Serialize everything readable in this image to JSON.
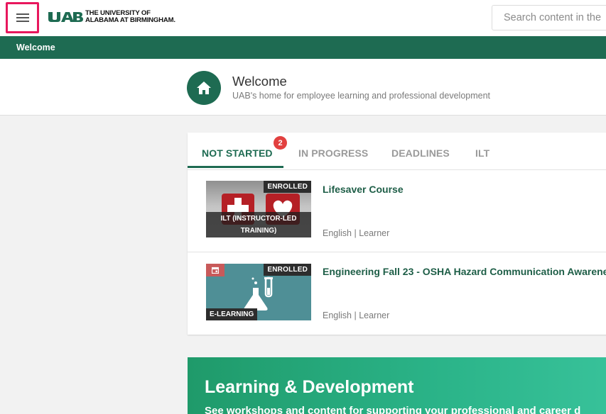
{
  "header": {
    "logo_mark": "UAB",
    "logo_line1": "THE UNIVERSITY OF",
    "logo_line2": "ALABAMA AT BIRMINGHAM.",
    "search_placeholder": "Search content in the p"
  },
  "nav": {
    "breadcrumb": "Welcome"
  },
  "welcome": {
    "title": "Welcome",
    "subtitle": "UAB's home for employee learning and professional development"
  },
  "tabs": [
    {
      "label": "NOT STARTED",
      "active": true,
      "badge": "2"
    },
    {
      "label": "IN PROGRESS",
      "active": false
    },
    {
      "label": "DEADLINES",
      "active": false
    },
    {
      "label": "ILT",
      "active": false
    }
  ],
  "courses": [
    {
      "title": "Lifesaver Course",
      "status": "ENROLLED",
      "type_line1": "ILT (INSTRUCTOR-LED",
      "type_line2": "TRAINING)",
      "meta": "English | Learner",
      "thumb_icon": "first-aid-heart-icon"
    },
    {
      "title": "Engineering Fall 23 - OSHA Hazard Communication Awarene",
      "status": "ENROLLED",
      "type": "E-LEARNING",
      "meta": "English | Learner",
      "thumb_icon": "lab-flask-icon"
    }
  ],
  "banner": {
    "title": "Learning & Development",
    "subtitle": "See workshops and content for supporting your professional and career d"
  },
  "colors": {
    "brand_green": "#1e6b52",
    "badge_red": "#e2403f",
    "highlight_pink": "#e8175d",
    "banner_teal": "#2bb489"
  }
}
